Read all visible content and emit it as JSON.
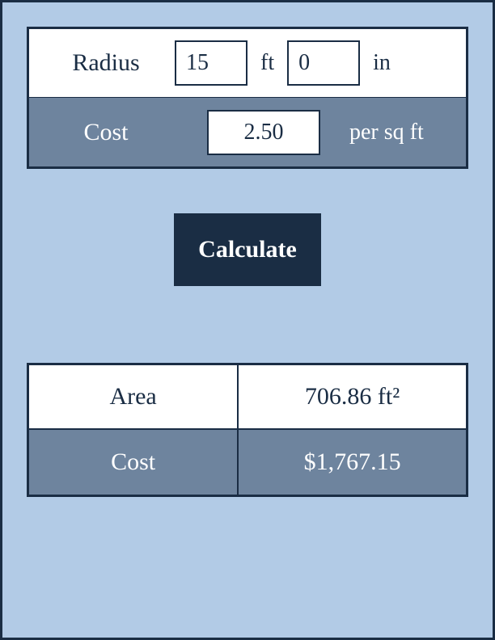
{
  "inputs": {
    "radius_label": "Radius",
    "radius_ft_value": "15",
    "radius_ft_unit": "ft",
    "radius_in_value": "0",
    "radius_in_unit": "in",
    "cost_label": "Cost",
    "cost_value": "2.50",
    "cost_unit": "per sq ft"
  },
  "actions": {
    "calculate_label": "Calculate"
  },
  "results": {
    "area_label": "Area",
    "area_value": "706.86 ft²",
    "cost_label": "Cost",
    "cost_value": "$1,767.15"
  }
}
